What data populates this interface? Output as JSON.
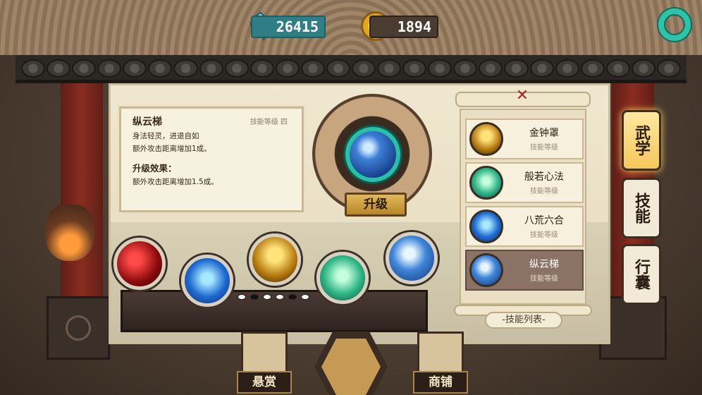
{
  "currency": {
    "jade": "26415",
    "coins": "1894"
  },
  "info": {
    "name": "纵云梯",
    "level": "技能等级  四",
    "desc": "身法轻灵，进退自如",
    "effect_now": "额外攻击距离增加1成。",
    "upgrade_title": "升级效果：",
    "effect_next": "额外攻击距离增加1.5成。"
  },
  "upgrade_label": "升级",
  "skill_list": {
    "items": [
      {
        "name": "金钟罩",
        "sub": "技能等级",
        "icon": "golden-bell-icon"
      },
      {
        "name": "般若心法",
        "sub": "技能等级",
        "icon": "green-hand-icon"
      },
      {
        "name": "八荒六合",
        "sub": "技能等级",
        "icon": "meditation-icon"
      },
      {
        "name": "纵云梯",
        "sub": "技能等级",
        "icon": "whirlwind-icon",
        "selected": true
      }
    ],
    "label": "-技能列表-"
  },
  "tabs": [
    {
      "label": "武学",
      "active": true
    },
    {
      "label": "技能",
      "active": false
    },
    {
      "label": "行囊",
      "active": false
    }
  ],
  "bottom": {
    "bounty": "悬赏",
    "shop": "商铺"
  },
  "board_stones": [
    "white",
    "black",
    "white",
    "white",
    "black",
    "white"
  ]
}
